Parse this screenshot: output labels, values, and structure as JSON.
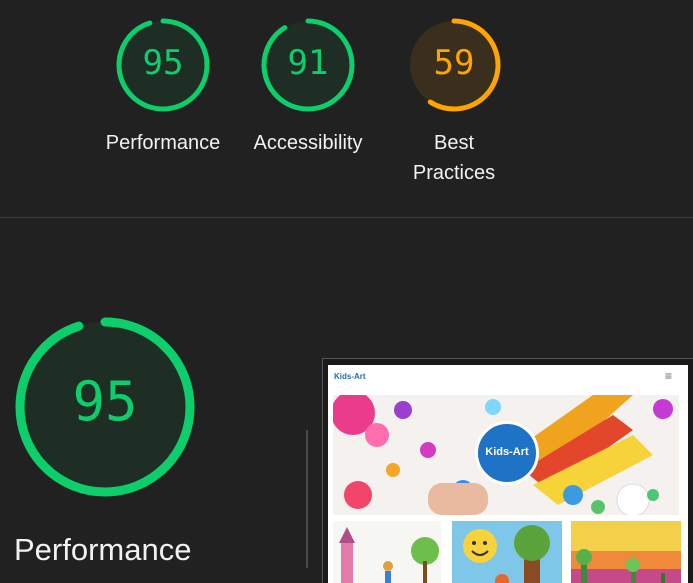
{
  "scores": [
    {
      "label": "Performance",
      "value": 95,
      "level": "pass"
    },
    {
      "label": "Accessibility",
      "value": 91,
      "level": "pass"
    },
    {
      "label": "Best\nPractices",
      "value": 59,
      "level": "average"
    }
  ],
  "section": {
    "title": "Performance",
    "score": 95
  },
  "thumbnail": {
    "site_logo": "Kids-Art",
    "menu_icon": "hamburger-icon",
    "hero_badge": "Kids-Art"
  },
  "colors": {
    "background": "#212121",
    "pass": "#0cce6b",
    "pass_fill": "#1e2e24",
    "average": "#ffa400",
    "average_fill": "#3a2e1c",
    "divider": "#3d3d3d"
  }
}
